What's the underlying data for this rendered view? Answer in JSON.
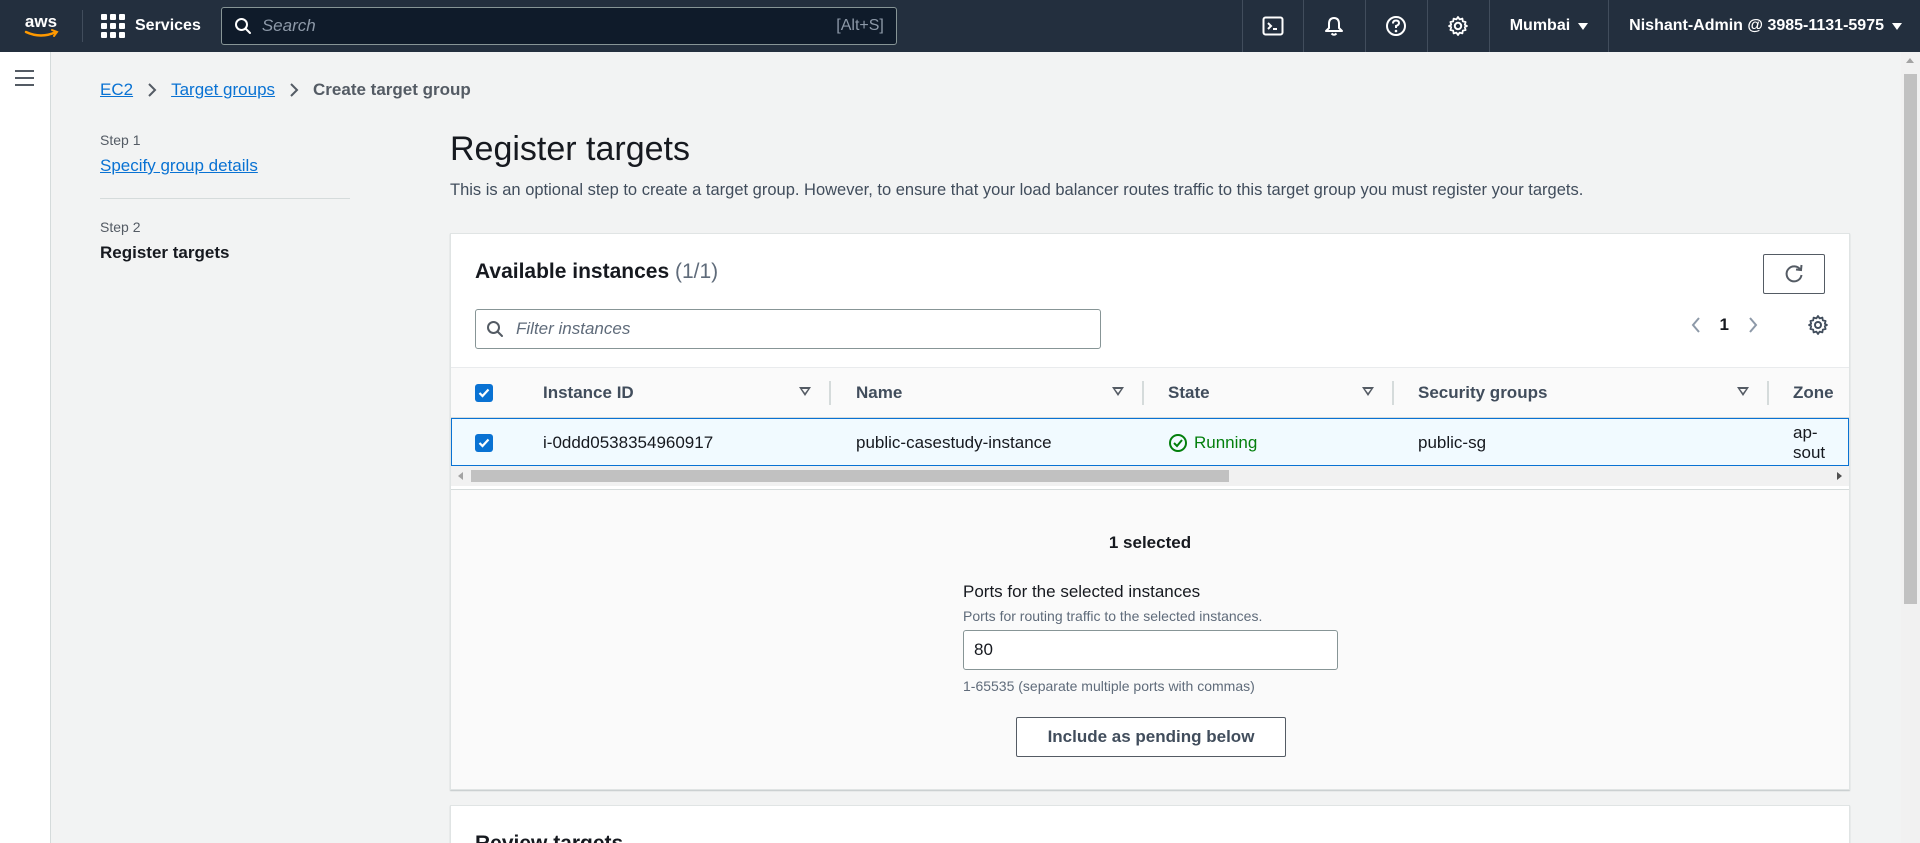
{
  "topnav": {
    "logo_text": "aws",
    "services_label": "Services",
    "search_placeholder": "Search",
    "search_shortcut": "[Alt+S]",
    "region": "Mumbai",
    "account": "Nishant-Admin @ 3985-1131-5975",
    "icons": [
      "cloudshell-icon",
      "bell-icon",
      "help-icon",
      "gear-icon"
    ]
  },
  "breadcrumb": {
    "items": [
      "EC2",
      "Target groups"
    ],
    "current": "Create target group"
  },
  "steps": [
    {
      "label": "Step 1",
      "title": "Specify group details"
    },
    {
      "label": "Step 2",
      "title": "Register targets"
    }
  ],
  "page": {
    "title": "Register targets",
    "description": "This is an optional step to create a target group. However, to ensure that your load balancer routes traffic to this target group you must register your targets."
  },
  "available": {
    "title": "Available instances",
    "count": "(1/1)",
    "filter_placeholder": "Filter instances",
    "page_number": "1",
    "columns": [
      "Instance ID",
      "Name",
      "State",
      "Security groups",
      "Zone"
    ],
    "rows": [
      {
        "instance_id": "i-0ddd0538354960917",
        "name": "public-casestudy-instance",
        "state": "Running",
        "security_groups": "public-sg",
        "zone": "ap-sout"
      }
    ],
    "selected_text": "1 selected",
    "ports_label": "Ports for the selected instances",
    "ports_desc": "Ports for routing traffic to the selected instances.",
    "ports_value": "80",
    "ports_hint": "1-65535 (separate multiple ports with commas)",
    "pending_button": "Include as pending below"
  },
  "review": {
    "title": "Review targets"
  },
  "colors": {
    "nav_bg": "#232f3e",
    "link": "#0972d3",
    "running": "#037f0c",
    "row_selected_bg": "#f1faff"
  }
}
